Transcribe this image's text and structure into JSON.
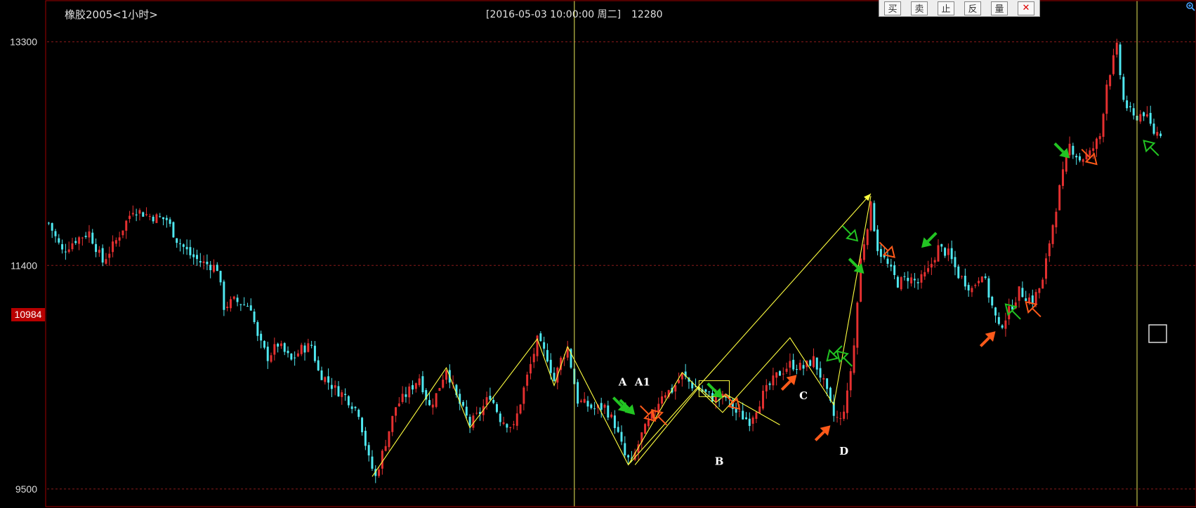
{
  "header": {
    "instrument": "橡胶2005<1小时>",
    "cursor_datetime": "[2016-05-03  10:00:00 周二]",
    "cursor_value": "12280"
  },
  "toolbar": {
    "buttons": [
      {
        "label": "买",
        "name": "buy-button"
      },
      {
        "label": "卖",
        "name": "sell-button"
      },
      {
        "label": "止",
        "name": "stop-button"
      },
      {
        "label": "反",
        "name": "reverse-button"
      },
      {
        "label": "量",
        "name": "volume-button"
      },
      {
        "label": "✕",
        "name": "close-button"
      }
    ]
  },
  "colors": {
    "background": "#000000",
    "border": "#a00000",
    "candle_up": "#e53030",
    "candle_down": "#4fe8f0",
    "trend_line": "#ffff40",
    "cursor_line": "#e8e85a",
    "grid": "#8a1a1a",
    "axis_text": "#dddddd",
    "last_price_bg": "#b80000",
    "arrow_green": "#22c422",
    "arrow_orange": "#ff5a1a",
    "annotation_text": "#ffffff"
  },
  "chart_data": {
    "type": "candlestick",
    "y_ticks": [
      13300,
      11400,
      9500
    ],
    "ylim": [
      9350,
      13650
    ],
    "last_price": "10984",
    "grid": "dashed horizontal lines at y ticks",
    "cursor_x_index": [
      156,
      323
    ],
    "annotations": [
      {
        "label": "A",
        "index": 172,
        "value": 10260
      },
      {
        "label": "A1",
        "index": 175,
        "value": 10260
      },
      {
        "label": "B",
        "index": 199,
        "value": 9955
      },
      {
        "label": "C",
        "index": 224,
        "value": 10440
      },
      {
        "label": "D",
        "index": 236,
        "value": 10030
      }
    ],
    "trend_zigzag": [
      [
        96,
        9605
      ],
      [
        118,
        10530
      ],
      [
        125,
        10020
      ],
      [
        145,
        10775
      ],
      [
        150,
        10380
      ],
      [
        154,
        10710
      ],
      [
        172,
        9705
      ],
      [
        188,
        10490
      ],
      [
        200,
        10150
      ],
      [
        220,
        10785
      ],
      [
        233,
        10215
      ],
      [
        244,
        11990
      ]
    ],
    "trend_zigzag_2": [
      [
        174,
        9705
      ],
      [
        193,
        10365
      ],
      [
        198,
        10235
      ],
      [
        201,
        10305
      ],
      [
        217,
        10045
      ]
    ],
    "trend_long_arrow": [
      [
        172,
        9705
      ],
      [
        244,
        12010
      ]
    ],
    "highlight_box": {
      "from_index": 193,
      "to_index": 202,
      "low": 10285,
      "high": 10420
    },
    "markers": [
      {
        "type": "solid",
        "color": "green",
        "index": 172,
        "value": 10150,
        "dir": "down-right"
      },
      {
        "type": "solid",
        "color": "green",
        "index": 174,
        "value": 10130,
        "dir": "down-right"
      },
      {
        "type": "hollow",
        "color": "orange",
        "index": 179,
        "value": 10170,
        "dir": "up-left"
      },
      {
        "type": "hollow",
        "color": "orange",
        "index": 180,
        "value": 10080,
        "dir": "down-right"
      },
      {
        "type": "solid",
        "color": "green",
        "index": 200,
        "value": 10270,
        "dir": "down-right"
      },
      {
        "type": "hollow",
        "color": "orange",
        "index": 205,
        "value": 10180,
        "dir": "down-right"
      },
      {
        "type": "solid",
        "color": "orange",
        "index": 222,
        "value": 10470,
        "dir": "up-right"
      },
      {
        "type": "hollow",
        "color": "green",
        "index": 231,
        "value": 10590,
        "dir": "down-left"
      },
      {
        "type": "hollow",
        "color": "green",
        "index": 234,
        "value": 10670,
        "dir": "up-left"
      },
      {
        "type": "solid",
        "color": "orange",
        "index": 232,
        "value": 10040,
        "dir": "up-right"
      },
      {
        "type": "hollow",
        "color": "green",
        "index": 240,
        "value": 11610,
        "dir": "down-right"
      },
      {
        "type": "solid",
        "color": "green",
        "index": 242,
        "value": 11330,
        "dir": "down-right"
      },
      {
        "type": "hollow",
        "color": "orange",
        "index": 251,
        "value": 11470,
        "dir": "down-right"
      },
      {
        "type": "solid",
        "color": "green",
        "index": 259,
        "value": 11550,
        "dir": "down-left"
      },
      {
        "type": "solid",
        "color": "orange",
        "index": 281,
        "value": 10840,
        "dir": "up-right"
      },
      {
        "type": "hollow",
        "color": "green",
        "index": 284,
        "value": 11070,
        "dir": "up-left"
      },
      {
        "type": "hollow",
        "color": "orange",
        "index": 290,
        "value": 11090,
        "dir": "up-left"
      },
      {
        "type": "solid",
        "color": "green",
        "index": 303,
        "value": 12310,
        "dir": "down-right"
      },
      {
        "type": "hollow",
        "color": "orange",
        "index": 311,
        "value": 12260,
        "dir": "down-right"
      },
      {
        "type": "hollow",
        "color": "green",
        "index": 325,
        "value": 12460,
        "dir": "up-left"
      }
    ],
    "price_path": [
      [
        0,
        11760
      ],
      [
        4,
        11520
      ],
      [
        8,
        11620
      ],
      [
        12,
        11680
      ],
      [
        16,
        11430
      ],
      [
        20,
        11610
      ],
      [
        25,
        11880
      ],
      [
        30,
        11820
      ],
      [
        35,
        11790
      ],
      [
        38,
        11620
      ],
      [
        42,
        11490
      ],
      [
        45,
        11430
      ],
      [
        50,
        11380
      ],
      [
        52,
        11050
      ],
      [
        55,
        11100
      ],
      [
        60,
        11050
      ],
      [
        62,
        10780
      ],
      [
        65,
        10620
      ],
      [
        68,
        10730
      ],
      [
        72,
        10590
      ],
      [
        75,
        10690
      ],
      [
        78,
        10720
      ],
      [
        80,
        10500
      ],
      [
        85,
        10350
      ],
      [
        88,
        10290
      ],
      [
        92,
        10150
      ],
      [
        95,
        9750
      ],
      [
        97,
        9600
      ],
      [
        100,
        9900
      ],
      [
        103,
        10200
      ],
      [
        106,
        10300
      ],
      [
        110,
        10450
      ],
      [
        113,
        10200
      ],
      [
        115,
        10300
      ],
      [
        118,
        10530
      ],
      [
        121,
        10280
      ],
      [
        125,
        10050
      ],
      [
        128,
        10150
      ],
      [
        131,
        10300
      ],
      [
        134,
        10100
      ],
      [
        138,
        10020
      ],
      [
        141,
        10350
      ],
      [
        145,
        10760
      ],
      [
        148,
        10620
      ],
      [
        150,
        10420
      ],
      [
        152,
        10600
      ],
      [
        154,
        10700
      ],
      [
        157,
        10250
      ],
      [
        162,
        10180
      ],
      [
        165,
        10200
      ],
      [
        168,
        10050
      ],
      [
        171,
        9780
      ],
      [
        173,
        9720
      ],
      [
        176,
        9960
      ],
      [
        179,
        10110
      ],
      [
        182,
        10310
      ],
      [
        185,
        10340
      ],
      [
        188,
        10470
      ],
      [
        191,
        10380
      ],
      [
        194,
        10330
      ],
      [
        198,
        10260
      ],
      [
        201,
        10280
      ],
      [
        204,
        10150
      ],
      [
        208,
        10080
      ],
      [
        212,
        10300
      ],
      [
        216,
        10460
      ],
      [
        220,
        10560
      ],
      [
        224,
        10530
      ],
      [
        227,
        10600
      ],
      [
        230,
        10400
      ],
      [
        233,
        10120
      ],
      [
        235,
        10080
      ],
      [
        237,
        10300
      ],
      [
        239,
        10720
      ],
      [
        241,
        11450
      ],
      [
        244,
        11900
      ],
      [
        246,
        11550
      ],
      [
        249,
        11400
      ],
      [
        252,
        11250
      ],
      [
        255,
        11300
      ],
      [
        258,
        11250
      ],
      [
        261,
        11350
      ],
      [
        264,
        11550
      ],
      [
        267,
        11500
      ],
      [
        270,
        11320
      ],
      [
        274,
        11200
      ],
      [
        277,
        11350
      ],
      [
        280,
        11050
      ],
      [
        282,
        10860
      ],
      [
        285,
        11010
      ],
      [
        288,
        11180
      ],
      [
        292,
        11100
      ],
      [
        295,
        11260
      ],
      [
        297,
        11600
      ],
      [
        300,
        12050
      ],
      [
        303,
        12420
      ],
      [
        306,
        12300
      ],
      [
        309,
        12350
      ],
      [
        312,
        12500
      ],
      [
        314,
        12950
      ],
      [
        317,
        13250
      ],
      [
        319,
        12800
      ],
      [
        322,
        12650
      ],
      [
        325,
        12700
      ],
      [
        328,
        12530
      ]
    ],
    "candle_count": 331
  }
}
